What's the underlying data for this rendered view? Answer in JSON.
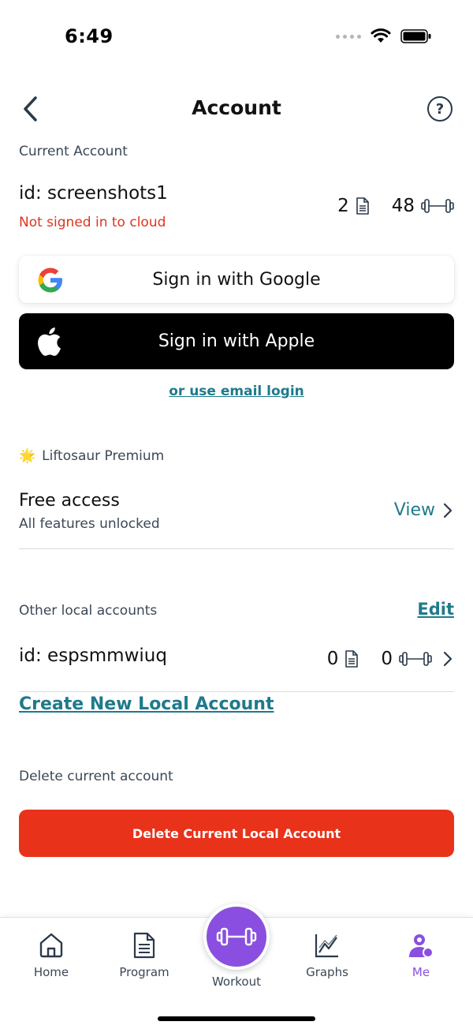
{
  "status": {
    "time": "6:49"
  },
  "header": {
    "title": "Account",
    "help": "?"
  },
  "current_account": {
    "section_label": "Current Account",
    "id": "id: screenshots1",
    "cloud_status": "Not signed in to cloud",
    "programs_count": "2",
    "workouts_count": "48"
  },
  "auth": {
    "google_label": "Sign in with Google",
    "apple_label": "Sign in with Apple",
    "email_link": "or use email login"
  },
  "premium": {
    "section_label": "Liftosaur Premium",
    "emoji": "🌟",
    "title": "Free access",
    "subtitle": "All features unlocked",
    "view_label": "View"
  },
  "local_accounts": {
    "section_label": "Other local accounts",
    "edit_label": "Edit",
    "accounts": [
      {
        "id": "id: espsmmwiuq",
        "programs_count": "0",
        "workouts_count": "0"
      }
    ],
    "create_label": "Create New Local Account"
  },
  "delete": {
    "section_label": "Delete current account",
    "button_label": "Delete Current Local Account"
  },
  "tabs": {
    "home": "Home",
    "program": "Program",
    "workout": "Workout",
    "graphs": "Graphs",
    "me": "Me"
  },
  "colors": {
    "accent": "#1f7a8c",
    "brand": "#8a4fe0",
    "danger": "#e8321a"
  }
}
